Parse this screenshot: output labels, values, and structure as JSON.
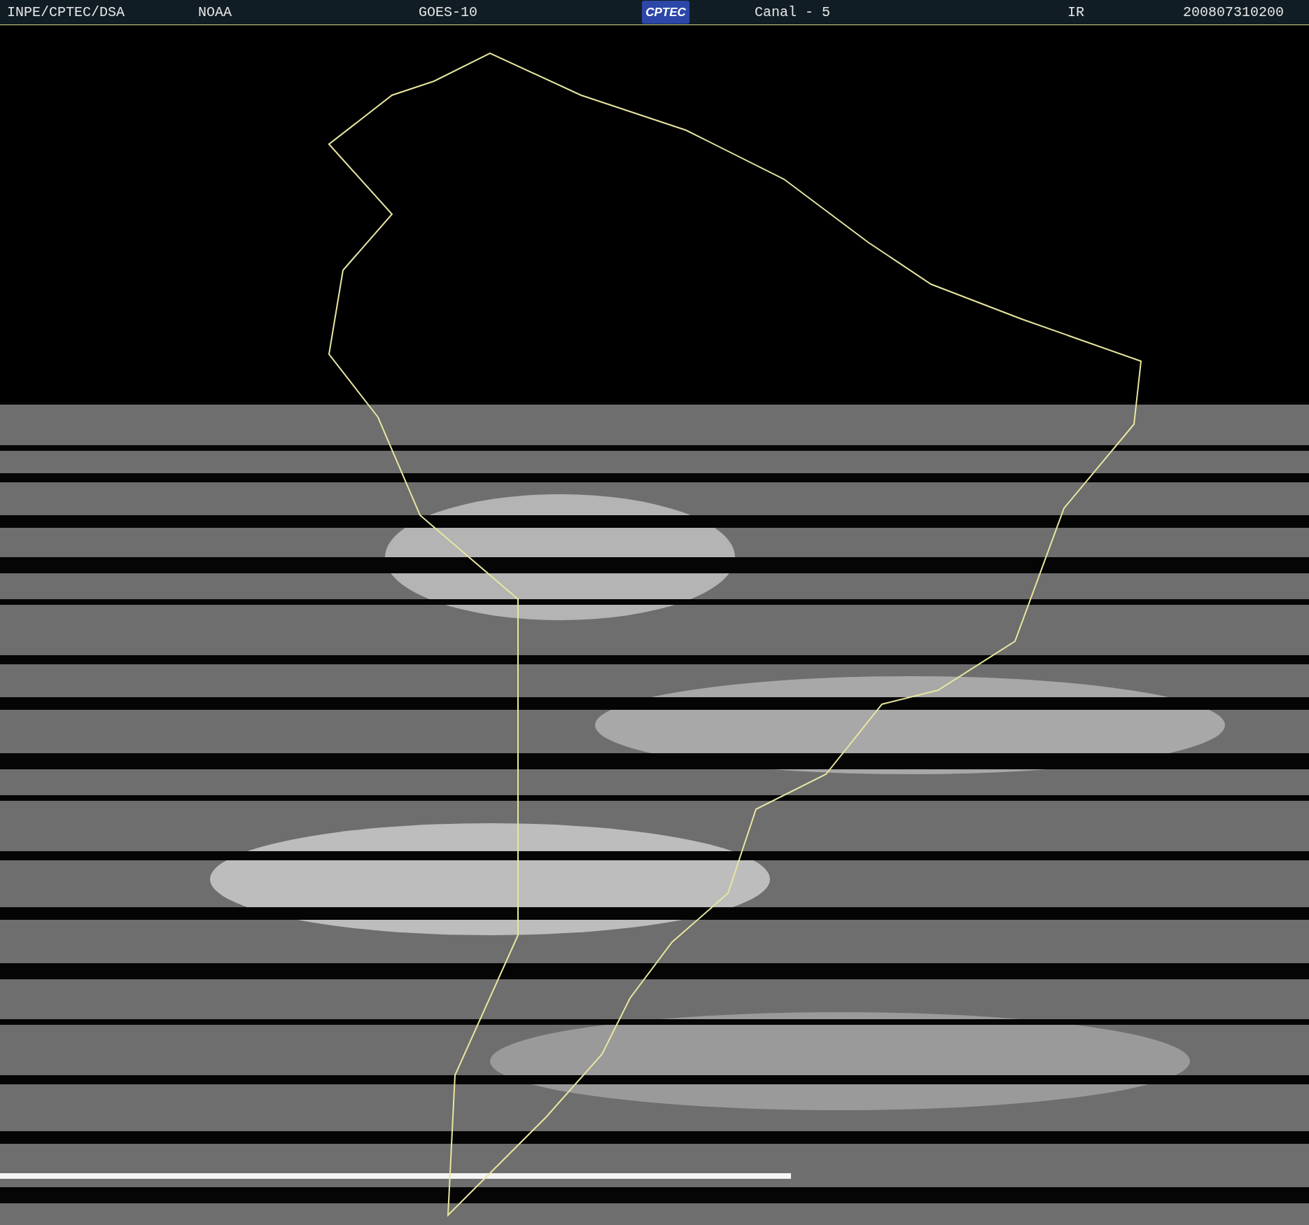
{
  "header": {
    "fields": [
      {
        "text": "INPE/CPTEC/DSA"
      },
      {
        "text": "NOAA"
      },
      {
        "text": "GOES-10"
      }
    ],
    "logo": "CPTEC",
    "fields_right": [
      {
        "text": "Canal - 5"
      },
      {
        "text": "IR"
      },
      {
        "text": "200807310200"
      }
    ]
  }
}
